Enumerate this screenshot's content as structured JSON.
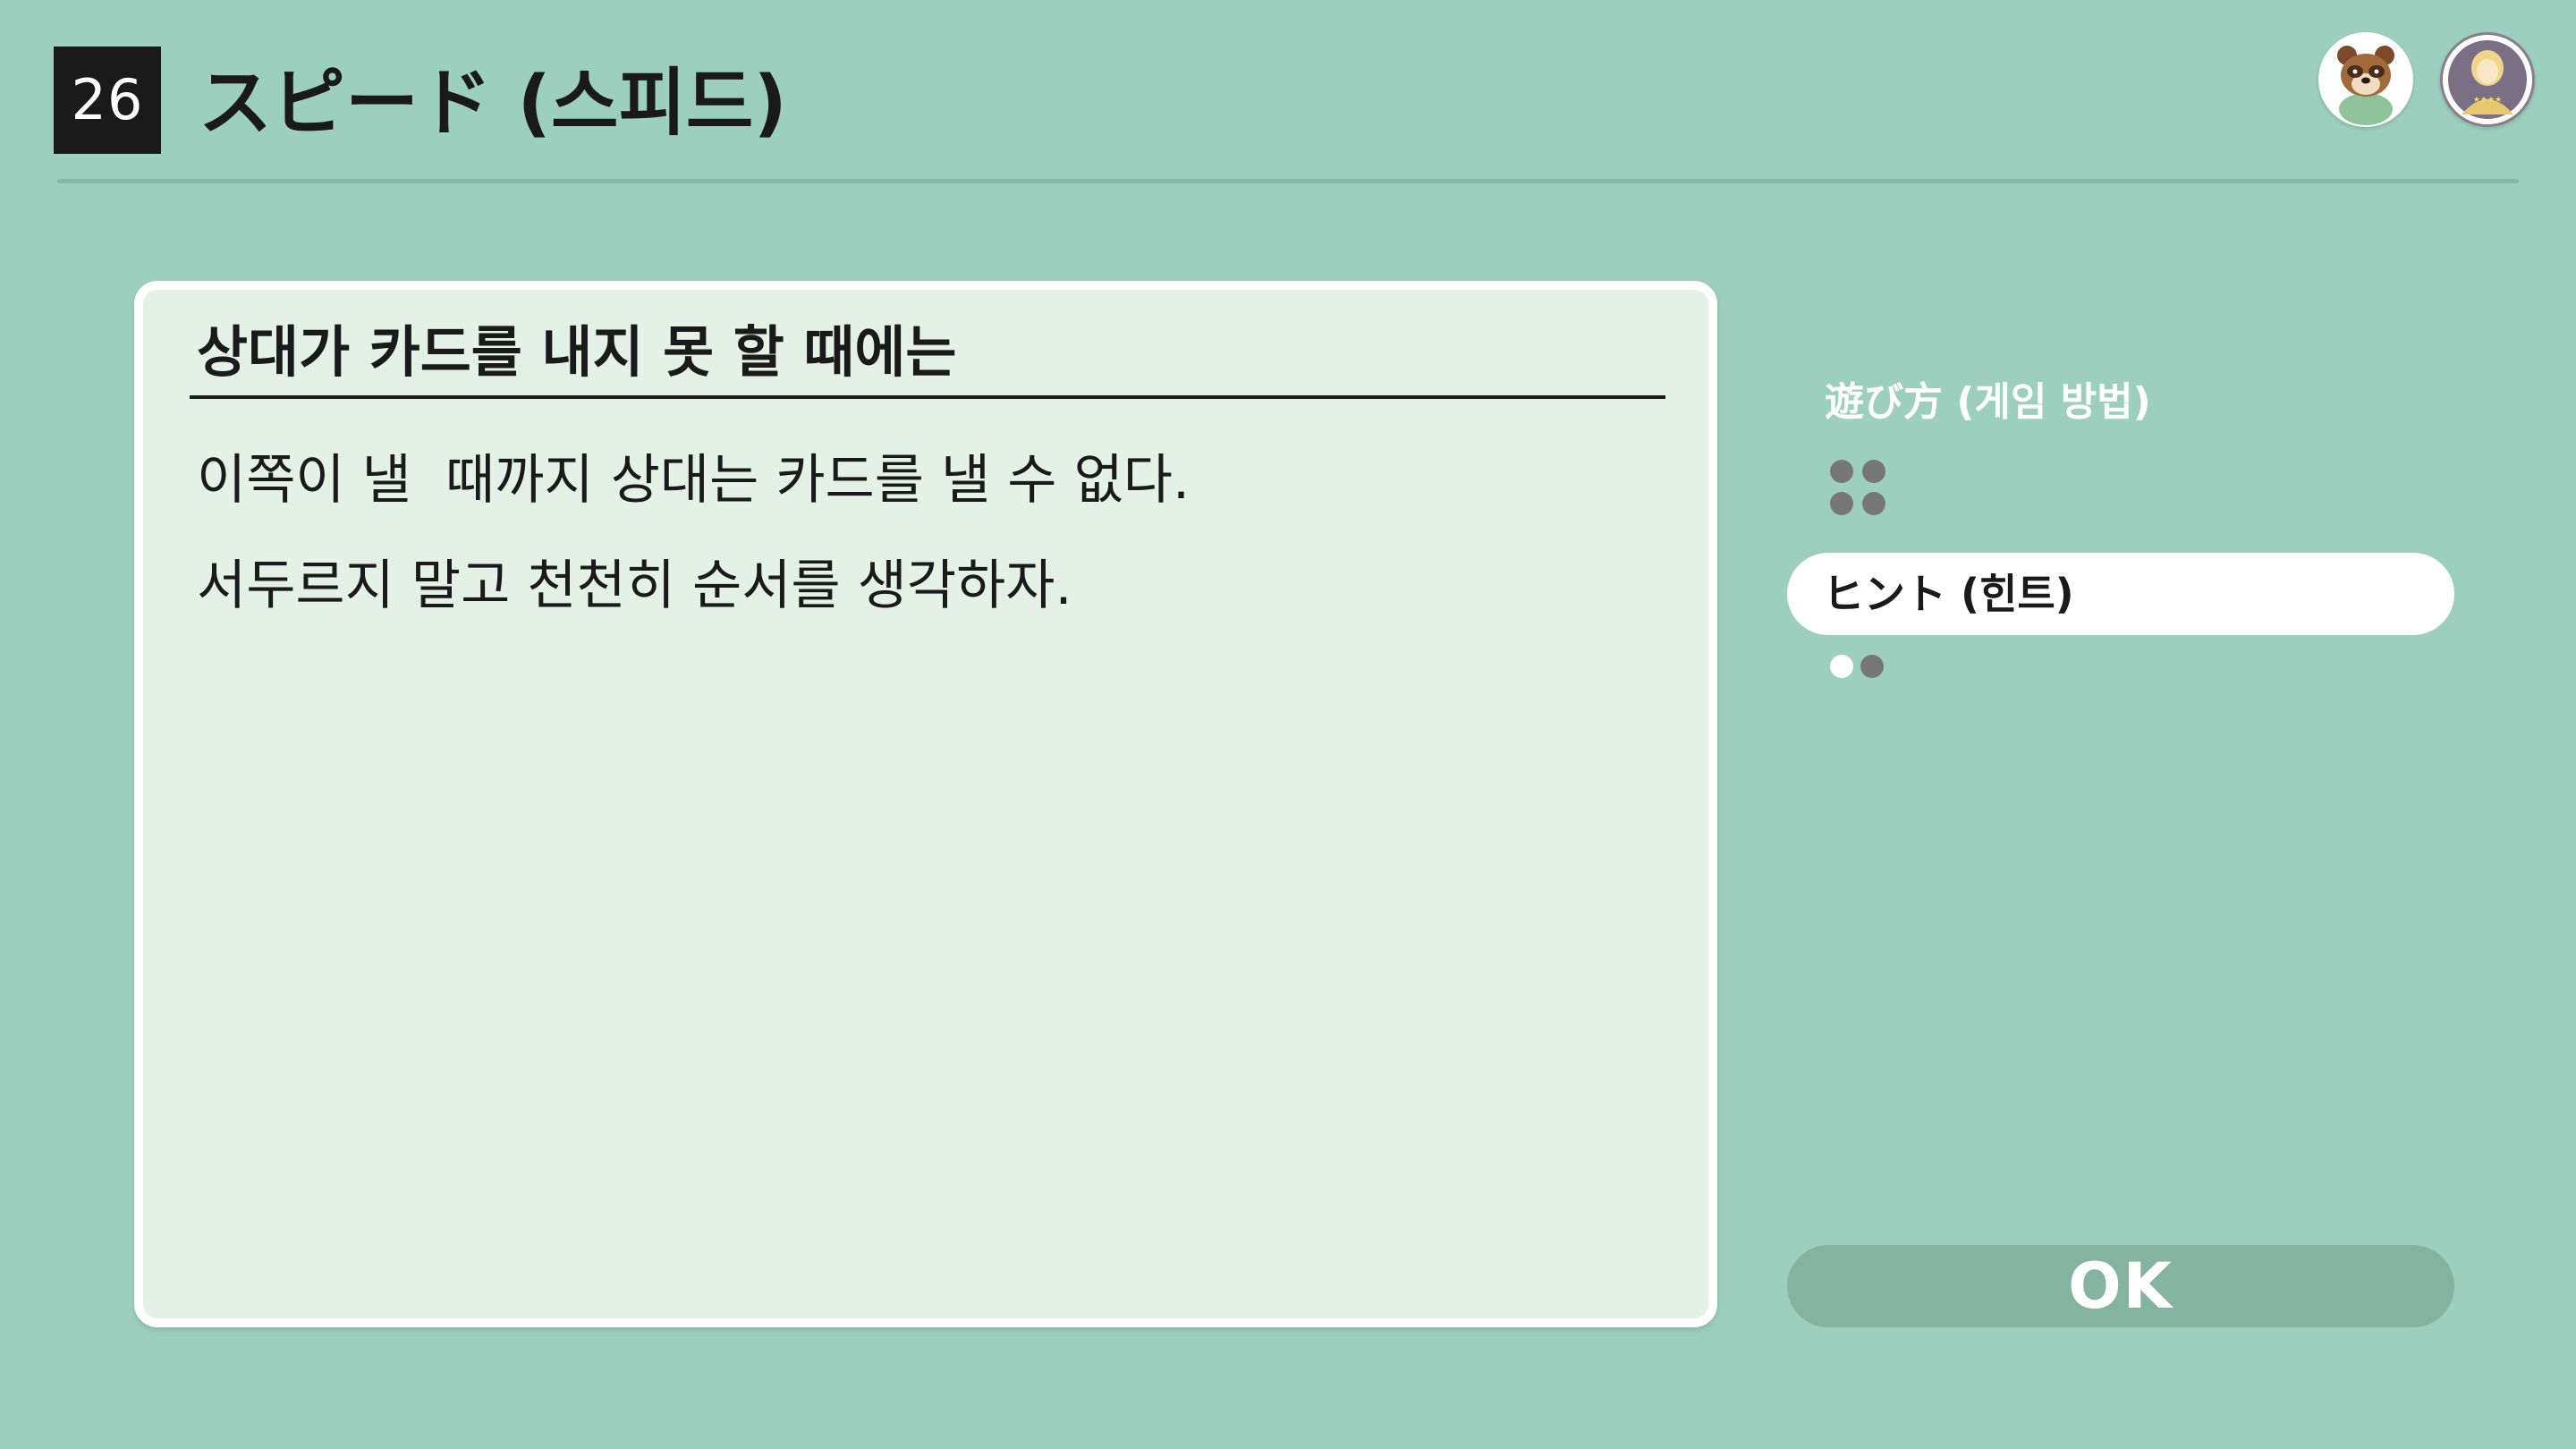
{
  "header": {
    "game_number": "26",
    "game_title": "スピード (스피드)"
  },
  "avatars": [
    {
      "icon": "tom-nook-avatar-icon"
    },
    {
      "icon": "user-avatar-icon"
    }
  ],
  "panel": {
    "heading": "상대가 카드를 내지 못 할 때에는",
    "lines": [
      "이쪽이 낼  때까지 상대는 카드를 낼 수 없다.",
      "서두르지 말고 천천히 순서를 생각하자."
    ]
  },
  "menu": {
    "section_label": "遊び方 (게임 방법)",
    "hint_label": "ヒント (힌트)",
    "pages": 2,
    "current_page": 1
  },
  "ok_label": "OK",
  "colors": {
    "background": "#9dcfbe",
    "panel_bg": "#e3f1e6",
    "ok_button": "#84b3a2",
    "dot_gray": "#777777",
    "dot_active": "#ffffff"
  }
}
